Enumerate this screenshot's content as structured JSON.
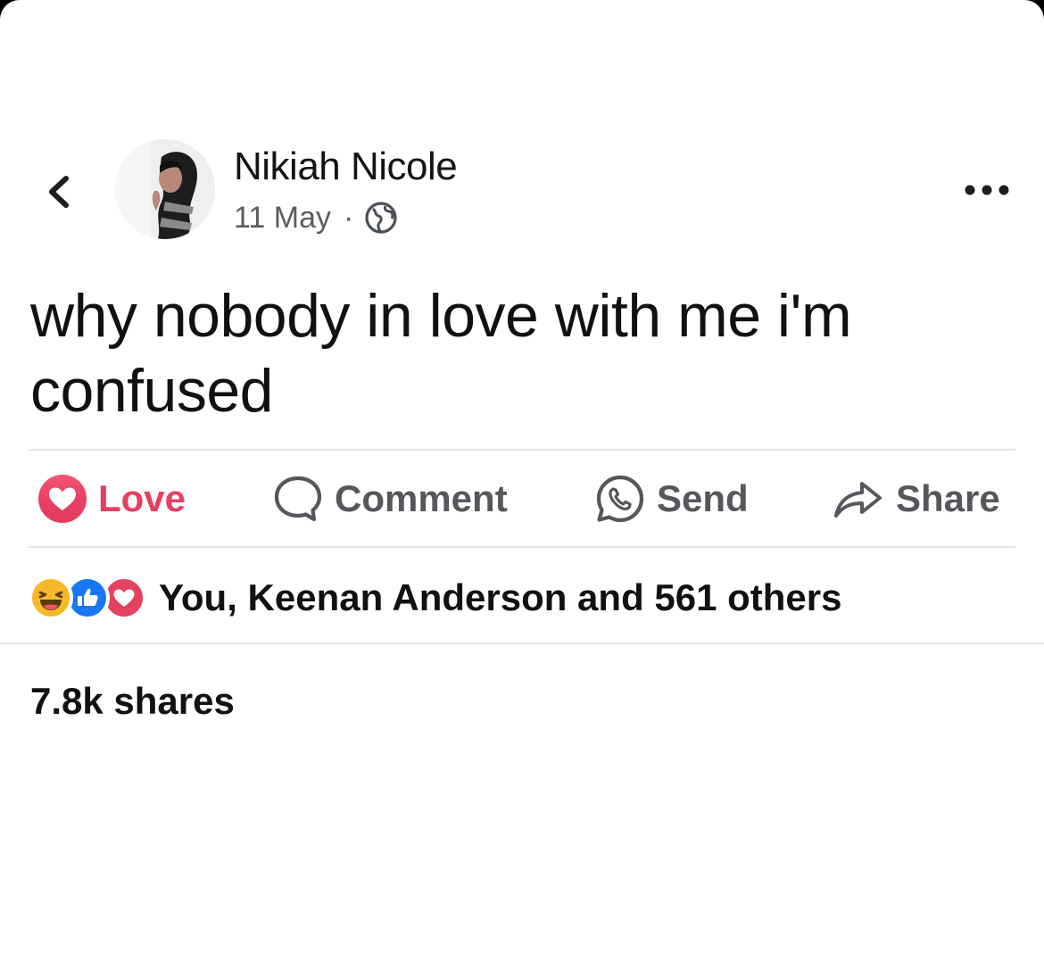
{
  "post": {
    "author": "Nikiah Nicole",
    "date": "11 May",
    "separator": "·",
    "privacy_icon": "globe-icon",
    "text": "why nobody in love with me i'm confused"
  },
  "actions": {
    "love_label": "Love",
    "comment_label": "Comment",
    "send_label": "Send",
    "share_label": "Share"
  },
  "reactions": {
    "icons": [
      "haha-icon",
      "like-icon",
      "love-icon"
    ],
    "summary": "You, Keenan Anderson and 561 others"
  },
  "shares": {
    "label": "7.8k shares"
  },
  "colors": {
    "love": "#e4405f",
    "like": "#1877f2",
    "haha": "#f7b928",
    "action_gray": "#54575b",
    "divider": "#e4e6e9"
  }
}
